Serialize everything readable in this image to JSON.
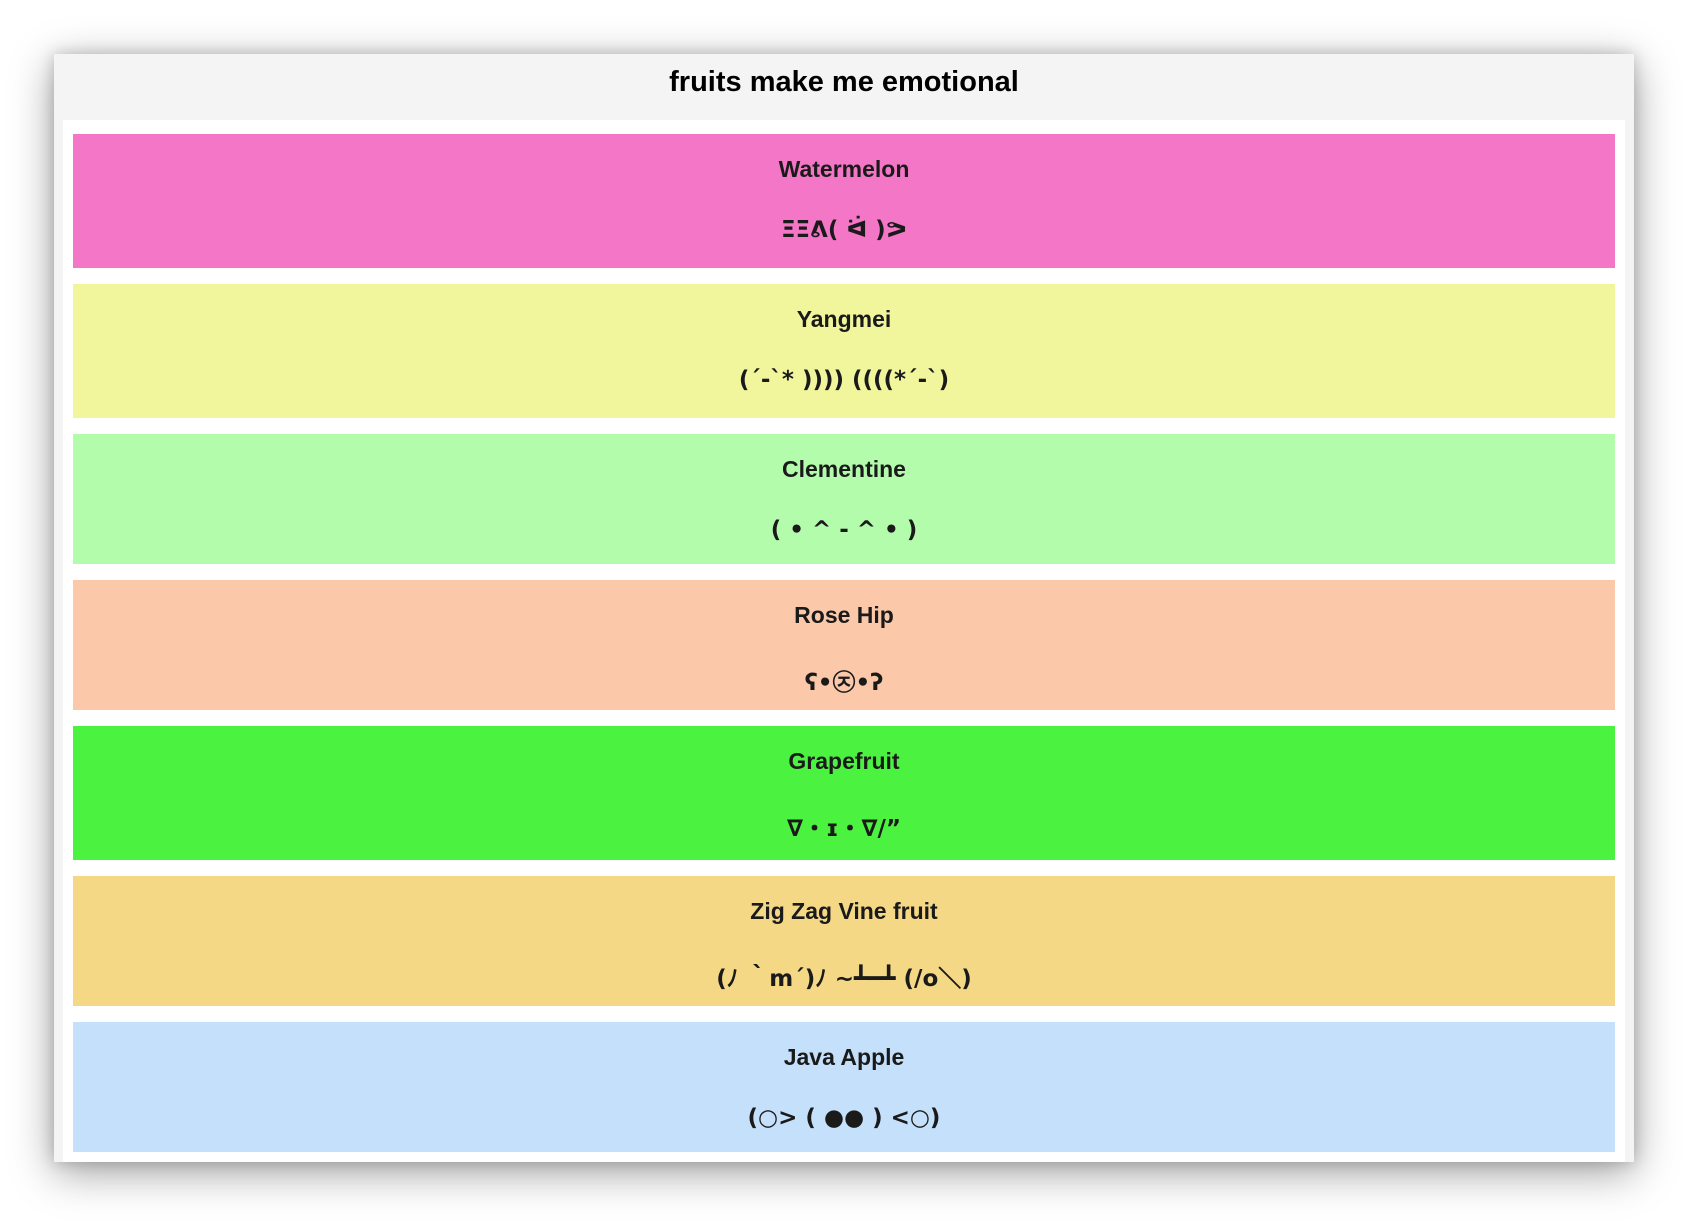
{
  "page": {
    "title": "fruits make me emotional"
  },
  "fruits": [
    {
      "name": "Watermelon",
      "face": "ΞΞᕕ( ᐛ )ᕗ",
      "color": "#f476c6"
    },
    {
      "name": "Yangmei",
      "face": "(´-`* )))) ((((*´-`)",
      "color": "#f1f59c"
    },
    {
      "name": "Clementine",
      "face": "( • ^ - ^ • )",
      "color": "#b2fcab"
    },
    {
      "name": "Rose Hip",
      "face": "ʕ•㉨•ʔ",
      "color": "#fbc8aa"
    },
    {
      "name": "Grapefruit",
      "face": "∇・ɪ・∇/”",
      "color": "#4cf240"
    },
    {
      "name": "Zig Zag Vine fruit",
      "face": "(ﾉ ｀m´)ﾉ ~┻━┻ (/o＼)",
      "color": "#f4d886"
    },
    {
      "name": "Java Apple",
      "face": "(○> ( ●● ) <○)",
      "color": "#c4e0fa"
    }
  ]
}
